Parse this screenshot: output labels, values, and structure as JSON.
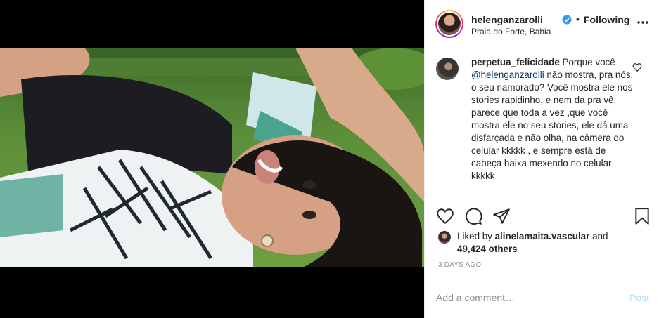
{
  "post": {
    "username": "helenganzarolli",
    "separator": "•",
    "follow_status": "Following",
    "location": "Praia do Forte, Bahia"
  },
  "comment": {
    "username": "perpetua_felicidade",
    "text_before": "Porque você",
    "mention": "@helenganzarolli",
    "text_after": "não mostra, pra nós, o seu namorado? Você mostra ele nos stories rapidinho, e nem da pra vê, parece que toda a vez ,que você mostra ele no seu stories, ele dá uma disfarçada e não olha, na câmera do celular kkkkk , e sempre está de cabeça baixa mexendo no celular kkkkk"
  },
  "likes": {
    "prefix": "Liked by",
    "liker": "alinelamaita.vascular",
    "conjunction": "and",
    "count": "49,424 others"
  },
  "timestamp": "3 DAYS AGO",
  "add_comment": {
    "placeholder": "Add a comment…",
    "post_label": "Post"
  },
  "icons": {
    "verified": "verified-badge-icon",
    "more": "more-options-icon",
    "like": "heart-icon",
    "comment": "comment-icon",
    "share": "paper-plane-icon",
    "save": "bookmark-icon"
  },
  "colors": {
    "verified_blue": "#3897f0",
    "mention": "#00376b",
    "post_disabled": "#b2dffc",
    "muted": "#8e8e8e"
  }
}
